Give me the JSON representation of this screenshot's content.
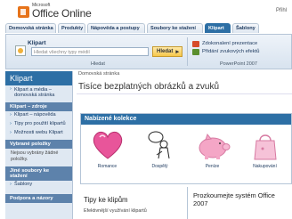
{
  "header": {
    "brand_small": "Microsoft",
    "brand": "Office Online",
    "login_hint": "Přihl"
  },
  "tabs": [
    {
      "label": "Domovská stránka"
    },
    {
      "label": "Produkty"
    },
    {
      "label": "Nápověda a postupy"
    },
    {
      "label": "Soubory ke stažení"
    },
    {
      "label": "Klipart"
    },
    {
      "label": "Šablony"
    }
  ],
  "toolbar": {
    "label": "Klipart",
    "search_placeholder": "Hledat všechny typy médií",
    "search_button": "Hledat",
    "group_caption": "Hledat",
    "items": [
      "Zdokonalení prezentace",
      "Přidání zvukových efektů"
    ],
    "right_caption": "PowerPoint 2007"
  },
  "nav": {
    "title": "Klipart",
    "link1": "Klipart a média – domovská stránka",
    "section1": "Klipart – zdroje",
    "link2": "Klipart – nápověda",
    "link3": "Tipy pro použití klipartů",
    "link4": "Možnosti webu Klipart",
    "section2": "Vybrané položky",
    "empty_note": "Nejsou vybrány žádné položky.",
    "section3": "Jiné soubory ke stažení",
    "link5": "Šablony",
    "section4": "Podpora a názory"
  },
  "main": {
    "breadcrumb": "Domovská stránka",
    "heading": "Tisíce bezplatných obrázků a zvuků",
    "featured_title": "Nabízené kolekce",
    "featured": [
      {
        "caption": "Romance"
      },
      {
        "caption": "Dospělý"
      },
      {
        "caption": "Peníze"
      },
      {
        "caption": "Nakupování"
      }
    ],
    "tips_title": "Tipy ke klipům",
    "tips_text": "Efektivnější využívání klipartů",
    "explore_title": "Prozkoumejte systém Office 2007"
  },
  "colors": {
    "accent": "#2d6fa5",
    "tab_bg": "#dfe7f1",
    "nav_bg": "#dfe8f2",
    "search_button": "#f6c74a",
    "heart": "#e8559a",
    "piggy": "#f4a6c6"
  }
}
